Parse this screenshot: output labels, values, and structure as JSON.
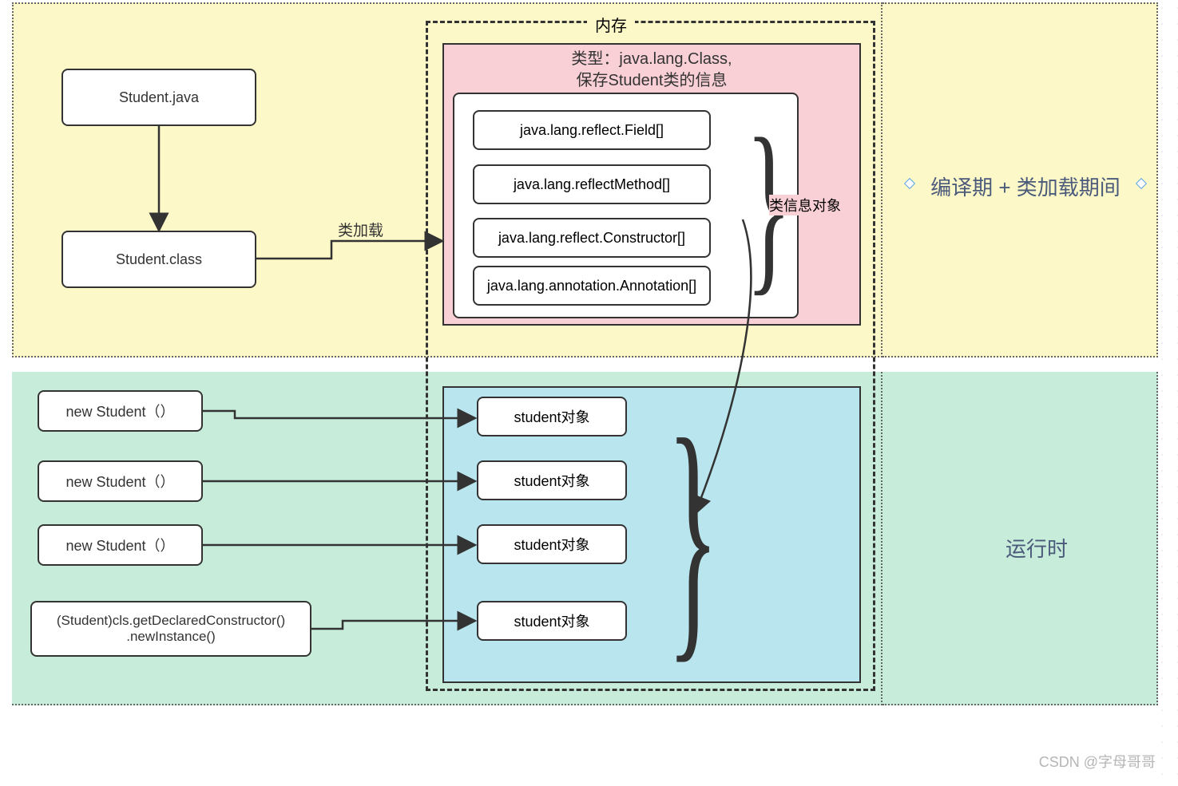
{
  "memory_label": "内存",
  "top_phase_label": "编译期 + 类加载期间",
  "bottom_phase_label": "运行时",
  "class_loading_label": "类加载",
  "class_info_label": "类信息对象",
  "source_file": "Student.java",
  "class_file": "Student.class",
  "pink_title_line1": "类型：java.lang.Class,",
  "pink_title_line2": "保存Student类的信息",
  "reflect": {
    "field": "java.lang.reflect.Field[]",
    "method": "java.lang.reflectMethod[]",
    "constructor": "java.lang.reflect.Constructor[]",
    "annotation": "java.lang.annotation.Annotation[]"
  },
  "new_student": "new Student（）",
  "reflect_newinstance_line1": "(Student)cls.getDeclaredConstructor()",
  "reflect_newinstance_line2": ".newInstance()",
  "student_object": "student对象",
  "watermark": "CSDN @字母哥哥"
}
